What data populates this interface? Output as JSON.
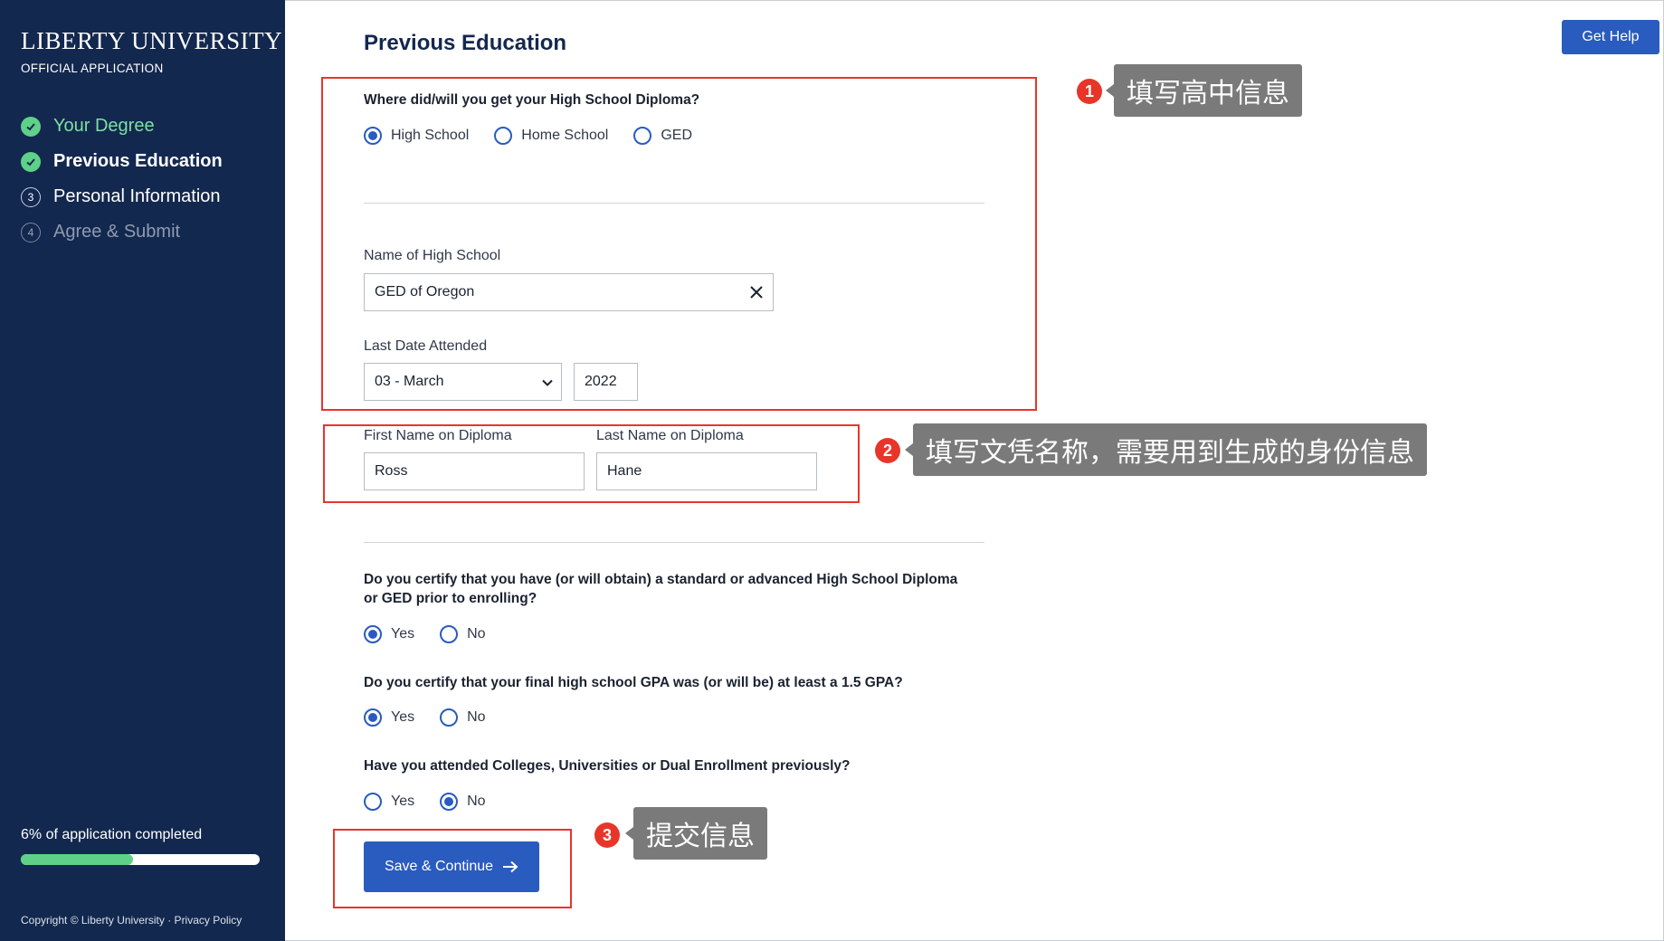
{
  "sidebar": {
    "logo": "LIBERTY UNIVERSITY",
    "subtitle": "OFFICIAL APPLICATION",
    "steps": [
      {
        "label": "Your Degree",
        "icon": "check-icon"
      },
      {
        "label": "Previous Education",
        "icon": "check-icon"
      },
      {
        "label": "Personal Information",
        "number": "3"
      },
      {
        "label": "Agree & Submit",
        "number": "4"
      }
    ],
    "progress_text": "6% of application completed",
    "progress_value": 0.06,
    "copyright": "Copyright © Liberty University · Privacy Policy"
  },
  "header": {
    "title": "Previous Education",
    "help_label": "Get Help"
  },
  "form": {
    "diploma_question": "Where did/will you get your High School Diploma?",
    "diploma_options": [
      "High School",
      "Home School",
      "GED"
    ],
    "diploma_selected": "High School",
    "school_name_label": "Name of High School",
    "school_name_value": "GED of Oregon",
    "last_date_label": "Last Date Attended",
    "month_value": "03 - March",
    "year_value": "2022",
    "first_name_label": "First Name on Diploma",
    "first_name_value": "Ross",
    "last_name_label": "Last Name on Diploma",
    "last_name_value": "Hane",
    "certify_diploma_question": "Do you certify that you have (or will obtain) a standard or advanced High School Diploma or GED prior to enrolling?",
    "certify_diploma_options": [
      "Yes",
      "No"
    ],
    "certify_diploma_selected": "Yes",
    "gpa_question": "Do you certify that your final high school GPA was (or will be) at least a 1.5 GPA?",
    "gpa_options": [
      "Yes",
      "No"
    ],
    "gpa_selected": "Yes",
    "college_question": "Have you attended Colleges, Universities or Dual Enrollment previously?",
    "college_options": [
      "Yes",
      "No"
    ],
    "college_selected": "No",
    "save_label": "Save & Continue"
  },
  "annotations": [
    {
      "number": "1",
      "text": "填写高中信息"
    },
    {
      "number": "2",
      "text": "填写文凭名称，需要用到生成的身份信息"
    },
    {
      "number": "3",
      "text": "提交信息"
    }
  ],
  "colors": {
    "sidebar_bg": "#13284f",
    "accent_blue": "#2a5bbf",
    "success_green": "#5fd088",
    "annotation_red": "#e8352a",
    "callout_gray": "#7a7a7a"
  }
}
